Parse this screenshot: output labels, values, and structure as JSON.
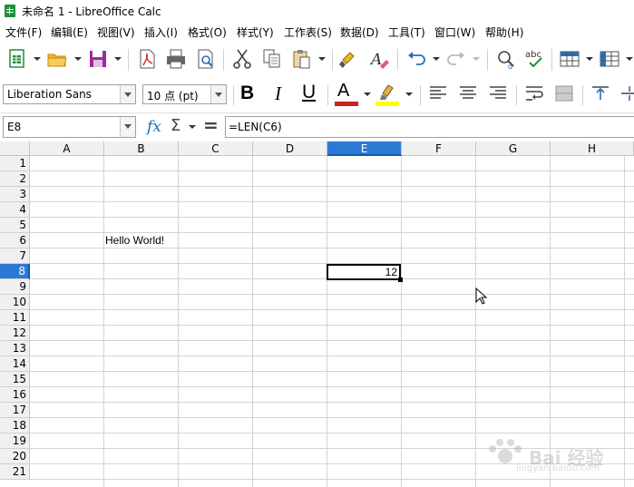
{
  "window": {
    "title": "未命名 1 - LibreOffice Calc"
  },
  "menu": [
    "文件(F)",
    "编辑(E)",
    "视图(V)",
    "插入(I)",
    "格式(O)",
    "样式(Y)",
    "工作表(S)",
    "数据(D)",
    "工具(T)",
    "窗口(W)",
    "帮助(H)"
  ],
  "format_toolbar": {
    "font_name": "Liberation Sans",
    "font_size": "10 点 (pt)",
    "bold": "B",
    "italic": "I",
    "underline": "U",
    "font_color_letter": "A",
    "font_color": "#c9211e",
    "highlight_color": "#ffff00"
  },
  "formula_bar": {
    "name_box": "E8",
    "function_wizard": "fx",
    "sum": "Σ",
    "equals": "=",
    "formula": "=LEN(C6)"
  },
  "sheet": {
    "columns": [
      "A",
      "B",
      "C",
      "D",
      "E",
      "F",
      "G",
      "H"
    ],
    "rows": [
      "1",
      "2",
      "3",
      "4",
      "5",
      "6",
      "7",
      "8",
      "9",
      "10",
      "11",
      "12",
      "13",
      "14",
      "15",
      "16",
      "17",
      "18",
      "19",
      "20",
      "21"
    ],
    "selected_column": "E",
    "selected_row": "8",
    "cells": {
      "C6": "Hello World!",
      "E8": "12"
    }
  },
  "watermark": {
    "text": "Bai 经验",
    "url": "jingyan.baidu.com"
  }
}
